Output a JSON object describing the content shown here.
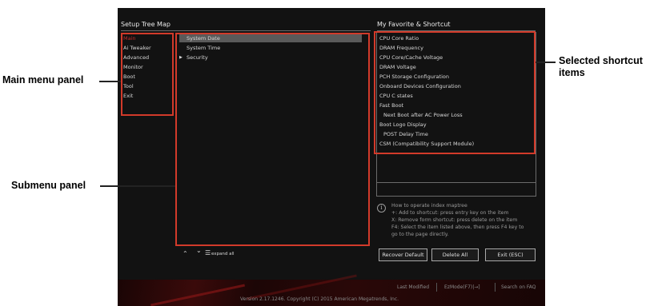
{
  "tree_map": {
    "title": "Setup Tree Map"
  },
  "main_menu": [
    {
      "label": "Main",
      "active": true
    },
    {
      "label": "Ai Tweaker"
    },
    {
      "label": "Advanced"
    },
    {
      "label": "Monitor"
    },
    {
      "label": "Boot"
    },
    {
      "label": "Tool"
    },
    {
      "label": "Exit"
    }
  ],
  "submenu": [
    {
      "label": "System Date",
      "selected": true
    },
    {
      "label": "System Time"
    },
    {
      "label": "Security",
      "has_children": true
    }
  ],
  "favorites": {
    "title": "My Favorite & Shortcut",
    "items": [
      {
        "label": "CPU Core Ratio"
      },
      {
        "label": "DRAM Frequency"
      },
      {
        "label": "CPU Core/Cache Voltage"
      },
      {
        "label": "DRAM Voltage"
      },
      {
        "label": "PCH Storage Configuration"
      },
      {
        "label": "Onboard Devices Configuration"
      },
      {
        "label": "CPU C states"
      },
      {
        "label": "Fast Boot"
      },
      {
        "label": "Next Boot after AC Power Loss",
        "indent": true
      },
      {
        "label": "Boot Logo Display"
      },
      {
        "label": "POST Delay Time",
        "indent": true
      },
      {
        "label": "CSM (Compatibility Support Module)"
      }
    ]
  },
  "controls": {
    "collapse_icon": "⌃",
    "expand_icon": "⌄",
    "expand_all_label": "expand all"
  },
  "help": {
    "icon": "i",
    "lines": [
      "How to operate index maptree",
      "+: Add to shortcut: press entry key on the item",
      "X: Remove form shortcut: press delete on the item",
      "F4: Select the item listed above, then press F4 key to",
      "go to the page directly."
    ]
  },
  "buttons": {
    "recover_default": "Recover Default",
    "delete_all": "Delete All",
    "exit": "Exit (ESC)"
  },
  "footer": {
    "last_modified": "Last Modified",
    "ezmode": "EzMode(F7)|→]",
    "search": "Search on FAQ",
    "version": "Version 2.17.1246. Copyright (C) 2015 American Megatrends, Inc."
  },
  "callouts": {
    "main_menu_panel": "Main menu panel",
    "submenu_panel": "Submenu panel",
    "selected_shortcut_line1": "Selected shortcut",
    "selected_shortcut_line2": "items"
  },
  "colors": {
    "highlight": "#d23a2a",
    "active_menu": "#c02a2a",
    "background": "#121212"
  }
}
